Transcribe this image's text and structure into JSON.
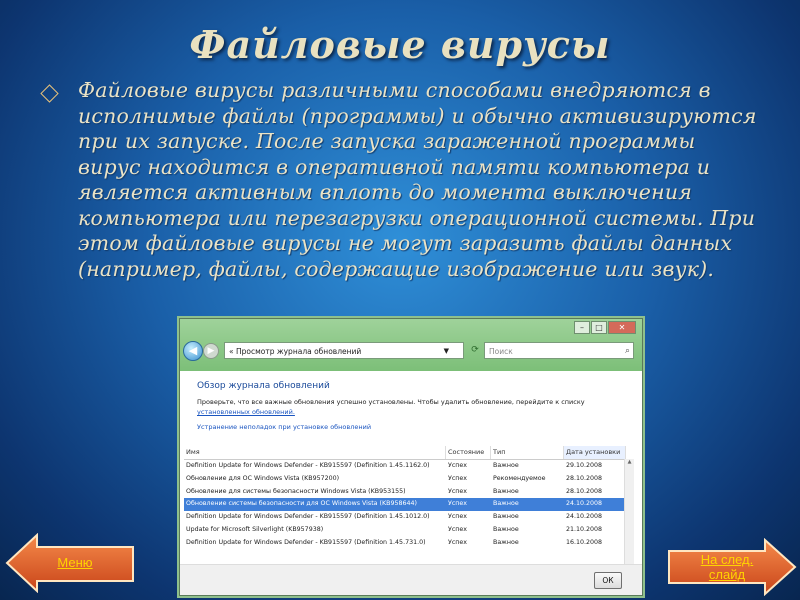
{
  "slide": {
    "title": "Файловые вирусы",
    "body": "Файловые вирусы различными способами внедряются в исполнимые файлы (программы) и обычно активизируются при их запуске. После запуска зараженной программы вирус находится в оперативной памяти компьютера и является активным вплоть до момента выключения компьютера или перезагрузки операционной системы. При этом файловые вирусы не могут заразить файлы данных (например, файлы, содержащие изображение или звук)."
  },
  "window": {
    "address": "Просмотр журнала обновлений",
    "search_placeholder": "Поиск",
    "heading": "Обзор журнала обновлений",
    "description": "Проверьте, что все важные обновления успешно установлены. Чтобы удалить обновление, перейдите к списку",
    "description_link": "установленных обновлений.",
    "troubleshoot_link": "Устранение неполадок при установке обновлений",
    "columns": [
      "Имя",
      "Состояние",
      "Тип",
      "Дата установки"
    ],
    "rows": [
      [
        "Definition Update for Windows Defender - KB915597 (Definition 1.45.1162.0)",
        "Успех",
        "Важное",
        "29.10.2008"
      ],
      [
        "Обновление для ОС Windows Vista (KB957200)",
        "Успех",
        "Рекомендуемое",
        "28.10.2008"
      ],
      [
        "Обновление для системы безопасности Windows Vista (KB953155)",
        "Успех",
        "Важное",
        "28.10.2008"
      ],
      [
        "Обновление системы безопасности для ОС Windows Vista (KB958644)",
        "Успех",
        "Важное",
        "24.10.2008"
      ],
      [
        "Definition Update for Windows Defender - KB915597 (Definition 1.45.1012.0)",
        "Успех",
        "Важное",
        "24.10.2008"
      ],
      [
        "Update for Microsoft Silverlight (KB957938)",
        "Успех",
        "Важное",
        "21.10.2008"
      ],
      [
        "Definition Update for Windows Defender - KB915597 (Definition 1.45.731.0)",
        "Успех",
        "Важное",
        "16.10.2008"
      ]
    ],
    "selected_row": 3,
    "ok_label": "ОК"
  },
  "nav": {
    "menu_label": "Меню",
    "next_label_line1": "На след.",
    "next_label_line2": "слайд"
  }
}
